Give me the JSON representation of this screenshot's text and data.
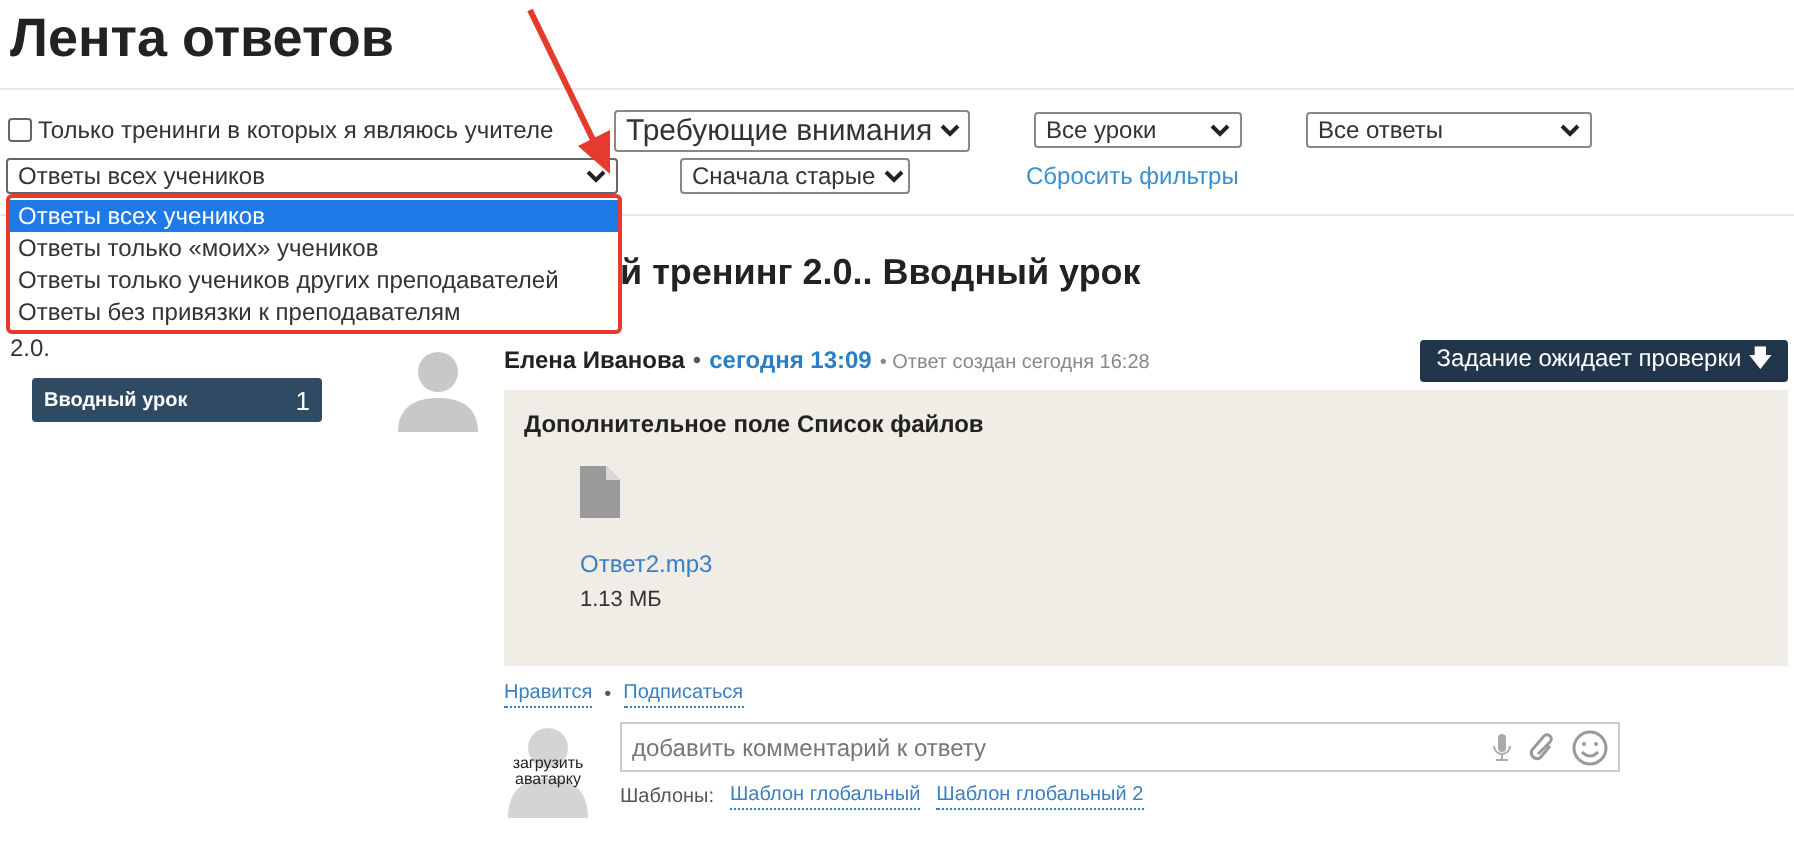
{
  "page_title": "Лента ответов",
  "filters": {
    "only_mine": {
      "label": "Только тренинги в которых я являюсь учителе",
      "checked": false
    },
    "row1": [
      {
        "value": "Требующие внимания",
        "kind": "large"
      },
      {
        "value": "Все уроки",
        "kind": "normal"
      },
      {
        "value": "Все ответы",
        "kind": "normal"
      }
    ],
    "students_select": {
      "value": "Ответы всех учеников",
      "expanded": true,
      "options": [
        {
          "label": "Ответы всех учеников",
          "selected": true
        },
        {
          "label": "Ответы только «моих» учеников",
          "selected": false
        },
        {
          "label": "Ответы только учеников других преподавателей",
          "selected": false
        },
        {
          "label": "Ответы без привязки к преподавателям",
          "selected": false
        }
      ]
    },
    "order_select": {
      "value": "Сначала старые"
    },
    "reset_link": "Сбросить фильтры"
  },
  "lesson_heading": "й тренинг 2.0.. Вводный урок",
  "sidebar": {
    "caption": "2.0.",
    "items": [
      {
        "label": "Вводный урок",
        "count": "1",
        "selected": true
      }
    ]
  },
  "answer": {
    "author": "Елена Иванова",
    "separator": "•",
    "time": "сегодня 13:09",
    "created": "• Ответ создан сегодня 16:28",
    "status_button": "Задание ожидает проверки",
    "status_icon": "🡇",
    "field_title": "Дополнительное поле Список файлов",
    "file": {
      "name": "Ответ2.mp3",
      "size": "1.13 МБ"
    },
    "actions": [
      "Нравится",
      "Подписаться"
    ],
    "actions_separator": "•",
    "comment": {
      "avatar_caption": "загрузить аватарку",
      "placeholder": "добавить комментарий к ответу"
    },
    "templates_label": "Шаблоны:",
    "templates": [
      "Шаблон глобальный",
      "Шаблон глобальный 2"
    ]
  }
}
